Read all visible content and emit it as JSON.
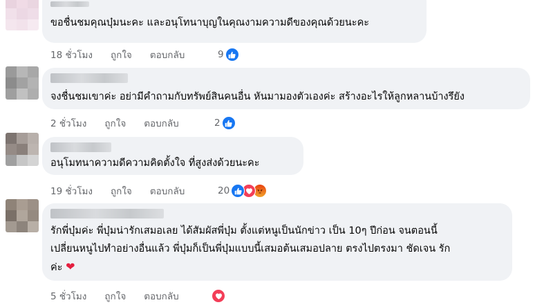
{
  "comments": [
    {
      "text_lines": [
        "ขอชื่นชมคุณบุ๋มนะคะ และอนุโทนาบุญในคุณงามความดีของคุณด้วยนะคะ"
      ],
      "time": "18 ชั่วโมง",
      "like_label": "ถูกใจ",
      "reply_label": "ตอบกลับ",
      "reaction_count": "9",
      "reactions": [
        "like-icon"
      ]
    },
    {
      "text_lines": [
        "จงชื่นชมเขาค่ะ อย่ามีคำถามกับทรัพย์สินคนอื่น หันมามองตัวเองค่ะ สร้างอะไรให้ลูกหลานบ้างรึยัง"
      ],
      "time": "2 ชั่วโมง",
      "like_label": "ถูกใจ",
      "reply_label": "ตอบกลับ",
      "reaction_count": "2",
      "reactions": [
        "like-icon"
      ]
    },
    {
      "text_lines": [
        "อนุโมทนาความดีความคิดตั้งใจ ที่สูงส่งด้วยนะคะ"
      ],
      "time": "19 ชั่วโมง",
      "like_label": "ถูกใจ",
      "reply_label": "ตอบกลับ",
      "reaction_count": "20",
      "reactions": [
        "like-icon",
        "love-icon",
        "angry-icon"
      ]
    },
    {
      "text_lines": [
        "รักพี่บุ๋มค่ะ พี่บุ๋มน่ารักเสมอเลย ได้สัมผัสพี่บุ๋ม ตั้งแต่หนูเป็นนักข่าว เป็น 10ๆ ปีก่อน จนตอนนี้",
        "เปลี่ยนหนูไปทำอย่างอื่นแล้ว พี่บุ๋มก็เป็นพี่บุ๋มแบบนี้เสมอต้นเสมอปลาย ตรงไปตรงมา ชัดเจน รัก",
        "ค่ะ"
      ],
      "time": "5 ชั่วโมง",
      "like_label": "ถูกใจ",
      "reply_label": "ตอบกลับ",
      "reaction_count": "",
      "reactions": [
        "love-icon"
      ]
    }
  ],
  "colors": {
    "like": "#1877f2",
    "love": "#f33e58",
    "angry": "#e9710f",
    "bubble": "#f0f2f5",
    "meta_text": "#65676b"
  }
}
